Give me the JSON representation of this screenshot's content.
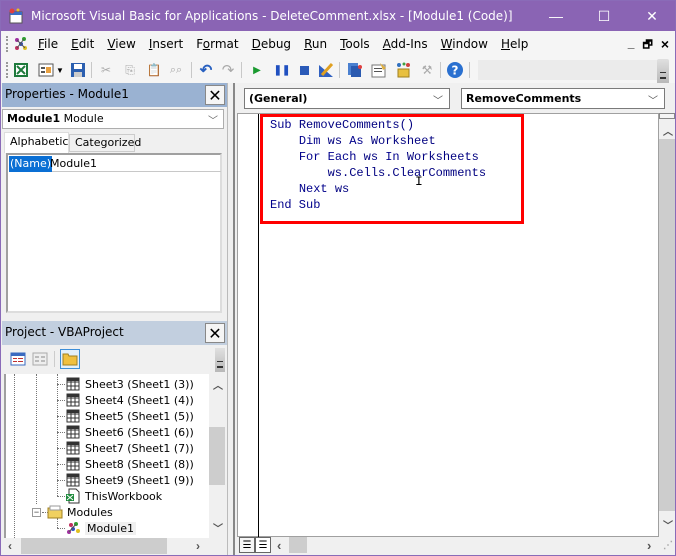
{
  "window": {
    "title": "Microsoft Visual Basic for Applications - DeleteComment.xlsx - [Module1 (Code)]",
    "minimize": "—",
    "maximize": "☐",
    "close": "✕"
  },
  "menubar": {
    "items": [
      {
        "label": "File",
        "accel": "F",
        "rest": "ile"
      },
      {
        "label": "Edit",
        "accel": "E",
        "rest": "dit"
      },
      {
        "label": "View",
        "accel": "V",
        "rest": "iew"
      },
      {
        "label": "Insert",
        "accel": "I",
        "rest": "nsert"
      },
      {
        "label": "Format",
        "accel_pre": "F",
        "accel": "o",
        "rest": "rmat"
      },
      {
        "label": "Debug",
        "accel": "D",
        "rest": "ebug"
      },
      {
        "label": "Run",
        "accel": "R",
        "rest": "un"
      },
      {
        "label": "Tools",
        "accel": "T",
        "rest": "ools"
      },
      {
        "label": "Add-Ins",
        "accel": "A",
        "rest": "dd-Ins"
      },
      {
        "label": "Window",
        "accel": "W",
        "rest": "indow"
      },
      {
        "label": "Help",
        "accel": "H",
        "rest": "elp"
      }
    ],
    "mdi_minimize": "_",
    "mdi_restore": "🗗",
    "mdi_close": "×"
  },
  "toolbar": {
    "buttons": [
      "view-excel",
      "insert-userform",
      "save",
      "cut",
      "copy",
      "paste",
      "find",
      "undo",
      "redo",
      "run",
      "break",
      "reset",
      "design-mode",
      "project-explorer",
      "properties-window",
      "object-browser",
      "toolbox",
      "help"
    ]
  },
  "properties": {
    "title": "Properties - Module1",
    "close": "✕",
    "object_name": "Module1",
    "object_type": "Module",
    "tabs": [
      "Alphabetic",
      "Categorized"
    ],
    "active_tab": "Alphabetic",
    "rows": [
      {
        "name": "(Name)",
        "value": "Module1"
      }
    ]
  },
  "project": {
    "title": "Project - VBAProject",
    "close": "✕",
    "tools": [
      "view-code",
      "view-object",
      "toggle-folders"
    ],
    "tree": [
      {
        "label": "Sheet3 (Sheet1 (3))",
        "type": "sheet"
      },
      {
        "label": "Sheet4 (Sheet1 (4))",
        "type": "sheet"
      },
      {
        "label": "Sheet5 (Sheet1 (5))",
        "type": "sheet"
      },
      {
        "label": "Sheet6 (Sheet1 (6))",
        "type": "sheet"
      },
      {
        "label": "Sheet7 (Sheet1 (7))",
        "type": "sheet"
      },
      {
        "label": "Sheet8 (Sheet1 (8))",
        "type": "sheet"
      },
      {
        "label": "Sheet9 (Sheet1 (9))",
        "type": "sheet"
      },
      {
        "label": "ThisWorkbook",
        "type": "workbook"
      },
      {
        "label": "Modules",
        "type": "folder",
        "expanded": true
      },
      {
        "label": "Module1",
        "type": "module",
        "selected": true
      }
    ]
  },
  "code": {
    "object_combo": "(General)",
    "procedure_combo": "RemoveComments",
    "lines": [
      [
        {
          "t": "Sub ",
          "k": true
        },
        {
          "t": "RemoveComments()",
          "k": false
        }
      ],
      [
        {
          "t": "    ",
          "k": false
        },
        {
          "t": "Dim ",
          "k": true
        },
        {
          "t": "ws ",
          "k": false
        },
        {
          "t": "As ",
          "k": true
        },
        {
          "t": "Worksheet",
          "k": false
        }
      ],
      [
        {
          "t": "    ",
          "k": false
        },
        {
          "t": "For Each ",
          "k": true
        },
        {
          "t": "ws ",
          "k": false
        },
        {
          "t": "In ",
          "k": true
        },
        {
          "t": "Worksheets",
          "k": false
        }
      ],
      [
        {
          "t": "        ws.Cells.ClearComments",
          "k": false
        }
      ],
      [
        {
          "t": "    ",
          "k": false
        },
        {
          "t": "Next ",
          "k": true
        },
        {
          "t": "ws",
          "k": false
        }
      ],
      [
        {
          "t": "End Sub",
          "k": true
        }
      ]
    ],
    "highlight_color": "#ff0000"
  }
}
